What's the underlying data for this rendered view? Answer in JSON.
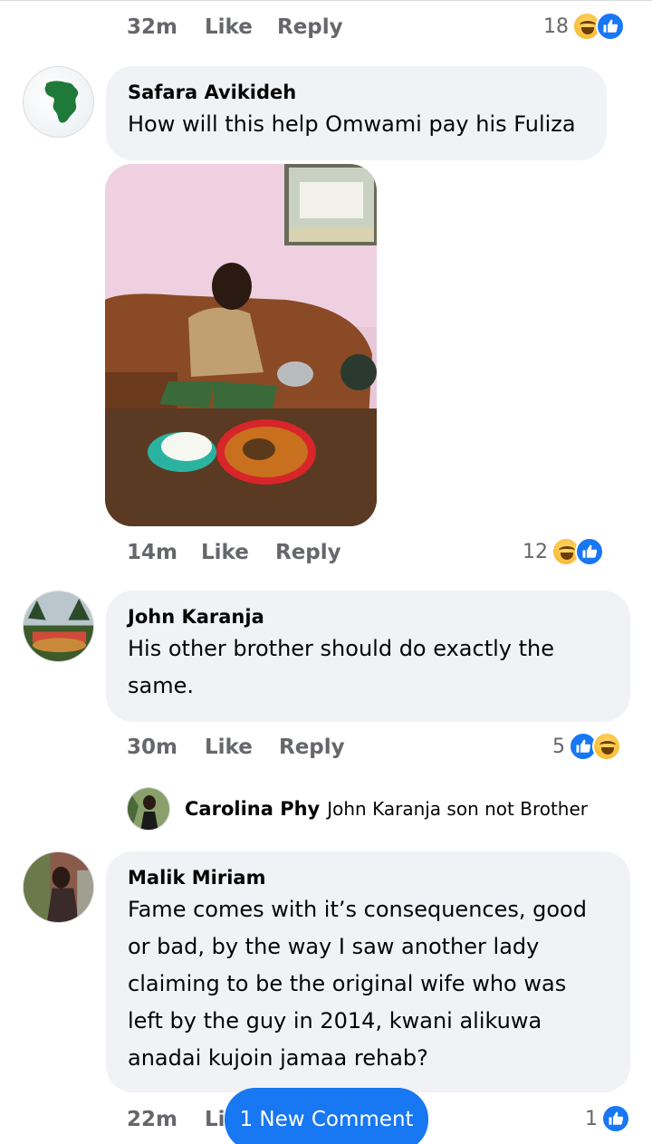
{
  "comments": [
    {
      "author": "",
      "text": "",
      "meta": {
        "time": "32m",
        "like": "Like",
        "reply": "Reply",
        "reactions_count": "18",
        "reactions": [
          "haha-icon",
          "like-icon"
        ]
      }
    },
    {
      "author": "Safara Avikideh",
      "text": "How will this help Omwami pay his Fuliza",
      "meta": {
        "time": "14m",
        "like": "Like",
        "reply": "Reply",
        "reactions_count": "12",
        "reactions": [
          "haha-icon",
          "like-icon"
        ]
      }
    },
    {
      "author": "John Karanja",
      "text_line1": "His other brother should do exactly the",
      "text_line2": "same.",
      "meta": {
        "time": "30m",
        "like": "Like",
        "reply": "Reply",
        "reactions_count": "5",
        "reactions": [
          "like-icon",
          "haha-icon"
        ]
      },
      "reply_preview": {
        "author": "Carolina Phy",
        "text": "John Karanja son not Brother"
      }
    },
    {
      "author": "Malik Miriam",
      "lines": [
        "Fame comes with it’s consequences, good",
        "or bad, by the way I saw another lady",
        "claiming to be the original wife who was",
        "left by the guy in 2014, kwani alikuwa",
        "anadai kujoin jamaa rehab?"
      ],
      "meta": {
        "time": "22m",
        "like": "Lik",
        "reactions_count": "1",
        "reactions": [
          "like-icon"
        ]
      }
    }
  ],
  "new_comment_button": "1 New Comment",
  "colors": {
    "accent": "#1877f2",
    "bubble": "#f0f2f5",
    "meta": "#65676b"
  }
}
